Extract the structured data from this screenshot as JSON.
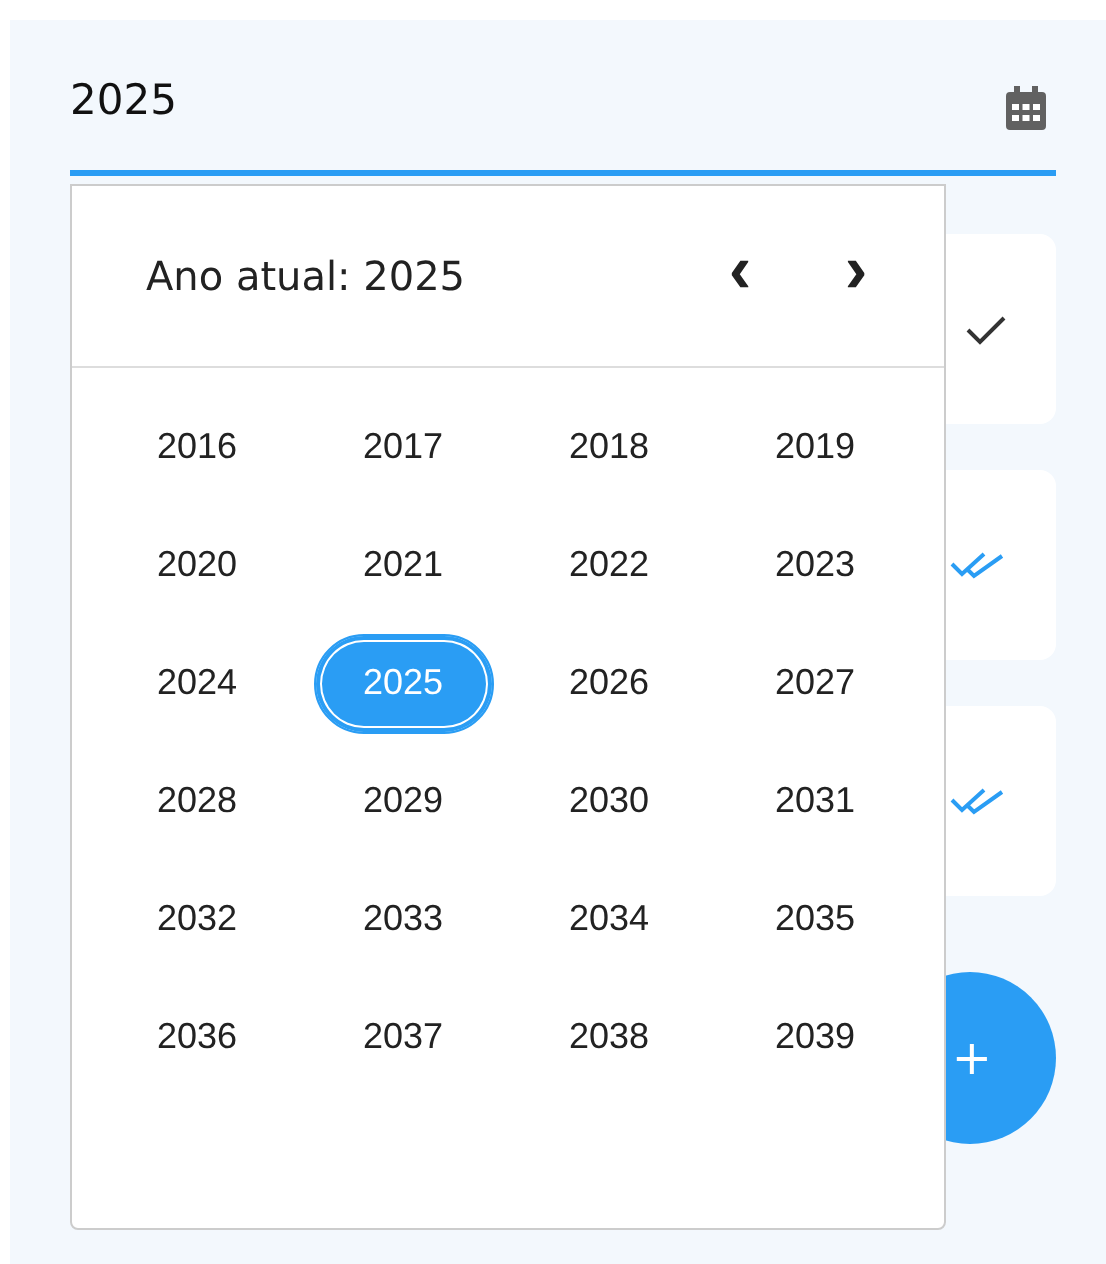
{
  "field": {
    "value": "2025"
  },
  "picker": {
    "title": "Ano atual: 2025",
    "prev": "‹",
    "next": "›",
    "years": [
      {
        "label": "2016",
        "selected": false
      },
      {
        "label": "2017",
        "selected": false
      },
      {
        "label": "2018",
        "selected": false
      },
      {
        "label": "2019",
        "selected": false
      },
      {
        "label": "2020",
        "selected": false
      },
      {
        "label": "2021",
        "selected": false
      },
      {
        "label": "2022",
        "selected": false
      },
      {
        "label": "2023",
        "selected": false
      },
      {
        "label": "2024",
        "selected": false
      },
      {
        "label": "2025",
        "selected": true
      },
      {
        "label": "2026",
        "selected": false
      },
      {
        "label": "2027",
        "selected": false
      },
      {
        "label": "2028",
        "selected": false
      },
      {
        "label": "2029",
        "selected": false
      },
      {
        "label": "2030",
        "selected": false
      },
      {
        "label": "2031",
        "selected": false
      },
      {
        "label": "2032",
        "selected": false
      },
      {
        "label": "2033",
        "selected": false
      },
      {
        "label": "2034",
        "selected": false
      },
      {
        "label": "2035",
        "selected": false
      },
      {
        "label": "2036",
        "selected": false
      },
      {
        "label": "2037",
        "selected": false
      },
      {
        "label": "2038",
        "selected": false
      },
      {
        "label": "2039",
        "selected": false
      }
    ]
  },
  "cards": [
    {
      "kind": "single"
    },
    {
      "kind": "double"
    },
    {
      "kind": "double"
    }
  ],
  "fab": {
    "label": "+"
  }
}
